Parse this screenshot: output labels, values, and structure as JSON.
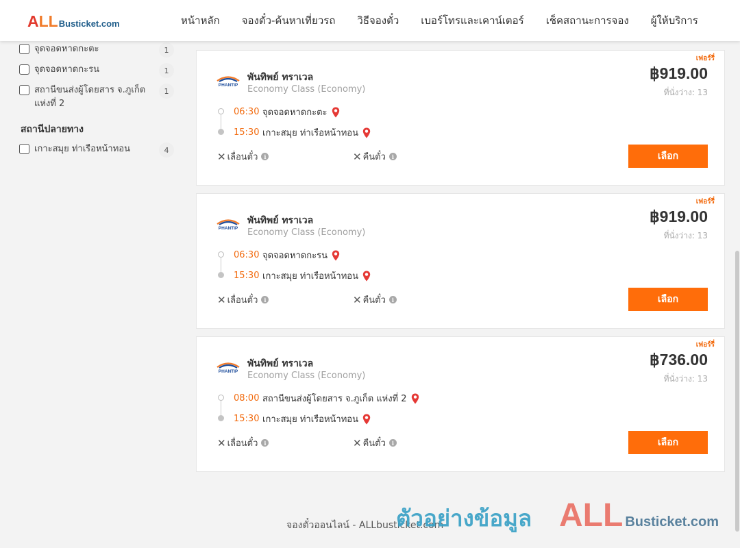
{
  "header": {
    "logo_all": "ALL",
    "logo_rest": "Busticket.com",
    "nav": [
      "หน้าหลัก",
      "จองตั๋ว-ค้นหาเที่ยวรถ",
      "วิธีจองตั๋ว",
      "เบอร์โทรและเคาน์เตอร์",
      "เช็คสถานะการจอง",
      "ผู้ให้บริการ"
    ]
  },
  "sidebar": {
    "boarding_points": [
      {
        "label": "จุดจอดหาดกะตะ",
        "count": "1"
      },
      {
        "label": "จุดจอดหาดกะรน",
        "count": "1"
      },
      {
        "label": "สถานีขนส่งผู้โดยสาร จ.ภูเก็ต แห่งที่ 2",
        "count": "1"
      }
    ],
    "destination_title": "สถานีปลายทาง",
    "destinations": [
      {
        "label": "เกาะสมุย ท่าเรือหน้าทอน",
        "count": "4"
      }
    ]
  },
  "trips": [
    {
      "promo": "เฟอร์รี่",
      "operator": "พันทิพย์ ทราเวล",
      "class": "Economy Class (Economy)",
      "price": "฿919.00",
      "seats": "ที่นั่งว่าง: 13",
      "depart_time": "06:30",
      "depart_place": "จุดจอดหาดกะตะ",
      "arrive_time": "15:30",
      "arrive_place": "เกาะสมุย ท่าเรือหน้าทอน",
      "reschedule": "เลื่อนตั๋ว",
      "refund": "คืนตั๋ว",
      "select": "เลือก"
    },
    {
      "promo": "เฟอร์รี่",
      "operator": "พันทิพย์ ทราเวล",
      "class": "Economy Class (Economy)",
      "price": "฿919.00",
      "seats": "ที่นั่งว่าง: 13",
      "depart_time": "06:30",
      "depart_place": "จุดจอดหาดกะรน",
      "arrive_time": "15:30",
      "arrive_place": "เกาะสมุย ท่าเรือหน้าทอน",
      "reschedule": "เลื่อนตั๋ว",
      "refund": "คืนตั๋ว",
      "select": "เลือก"
    },
    {
      "promo": "เฟอร์รี่",
      "operator": "พันทิพย์ ทราเวล",
      "class": "Economy Class (Economy)",
      "price": "฿736.00",
      "seats": "ที่นั่งว่าง: 13",
      "depart_time": "08:00",
      "depart_place": "สถานีขนส่งผู้โดยสาร จ.ภูเก็ต แห่งที่ 2",
      "arrive_time": "15:30",
      "arrive_place": "เกาะสมุย ท่าเรือหน้าทอน",
      "reschedule": "เลื่อนตั๋ว",
      "refund": "คืนตั๋ว",
      "select": "เลือก"
    }
  ],
  "operator_logo_text": "PHANTIP",
  "footer": {
    "text": "จองตั๋วออนไลน์ - ALLbusticket.com",
    "watermark_text": "ตัวอย่างข้อมูล",
    "watermark_logo_all": "ALL",
    "watermark_logo_rest": "Busticket.com"
  },
  "colors": {
    "accent": "#ff6d0a",
    "time": "#f26b0f",
    "pin": "#e53935"
  },
  "icons": [
    "checkbox-icon",
    "map-pin-icon",
    "close-x-icon",
    "info-icon",
    "phantip-logo"
  ]
}
